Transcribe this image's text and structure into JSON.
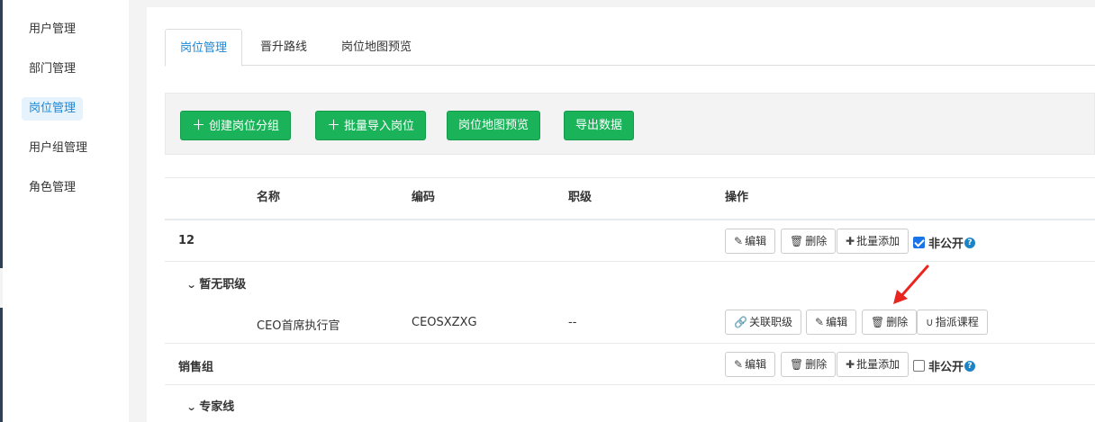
{
  "sidebar": {
    "items": [
      {
        "label": "用户管理"
      },
      {
        "label": "部门管理"
      },
      {
        "label": "岗位管理",
        "active": true
      },
      {
        "label": "用户组管理"
      },
      {
        "label": "角色管理"
      }
    ]
  },
  "tabs": [
    {
      "label": "岗位管理",
      "active": true
    },
    {
      "label": "晋升路线"
    },
    {
      "label": "岗位地图预览"
    }
  ],
  "toolbar": {
    "create_group": "创建岗位分组",
    "batch_import": "批量导入岗位",
    "map_preview": "岗位地图预览",
    "export": "导出数据"
  },
  "table": {
    "headers": {
      "name": "名称",
      "code": "编码",
      "level": "职级",
      "actions": "操作"
    },
    "groups": [
      {
        "name": "12",
        "public_label": "非公开",
        "checked": true,
        "subgroups": [
          {
            "name": "暂无职级",
            "positions": [
              {
                "name": "CEO首席执行官",
                "code": "CEOSXZXG",
                "level": "--"
              }
            ]
          }
        ]
      },
      {
        "name": "销售组",
        "public_label": "非公开",
        "checked": false,
        "subgroups": [
          {
            "name": "专家线",
            "positions": []
          }
        ]
      }
    ],
    "actions": {
      "edit": "编辑",
      "delete": "删除",
      "batch_add": "批量添加",
      "link_level": "关联职级",
      "assign_course": "指派课程"
    }
  },
  "colors": {
    "accent": "#1a87d6",
    "primary_button": "#1ab35a",
    "annotation_arrow": "#e8261f"
  }
}
